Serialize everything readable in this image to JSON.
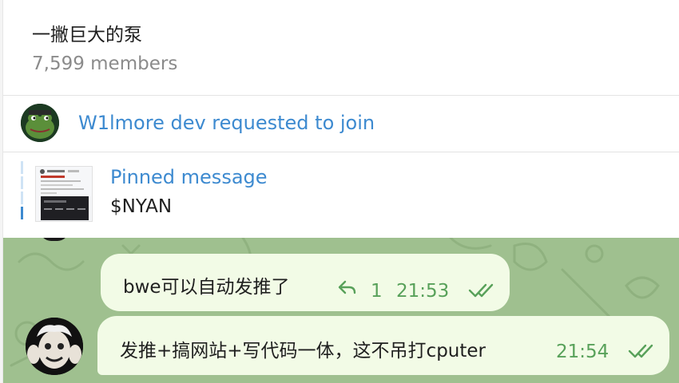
{
  "header": {
    "title": "一撇巨大的泵",
    "members": "7,599 members"
  },
  "join_request": {
    "text": "W1lmore dev requested to join",
    "avatar_icon": "frog-avatar-icon"
  },
  "pinned": {
    "title": "Pinned message",
    "text": "$NYAN"
  },
  "messages": [
    {
      "text": "bwe可以自动发推了",
      "reply_count": "1",
      "time": "21:53",
      "status_icon": "double-check-icon"
    },
    {
      "text": "发推+搞网站+写代码一体，这不吊打cputer",
      "time": "21:54",
      "status_icon": "double-check-icon"
    }
  ],
  "colors": {
    "accent": "#3d8ad0",
    "bubble": "#f2fbe6",
    "meta": "#58a15a",
    "chat_background": "#9fc08f"
  }
}
